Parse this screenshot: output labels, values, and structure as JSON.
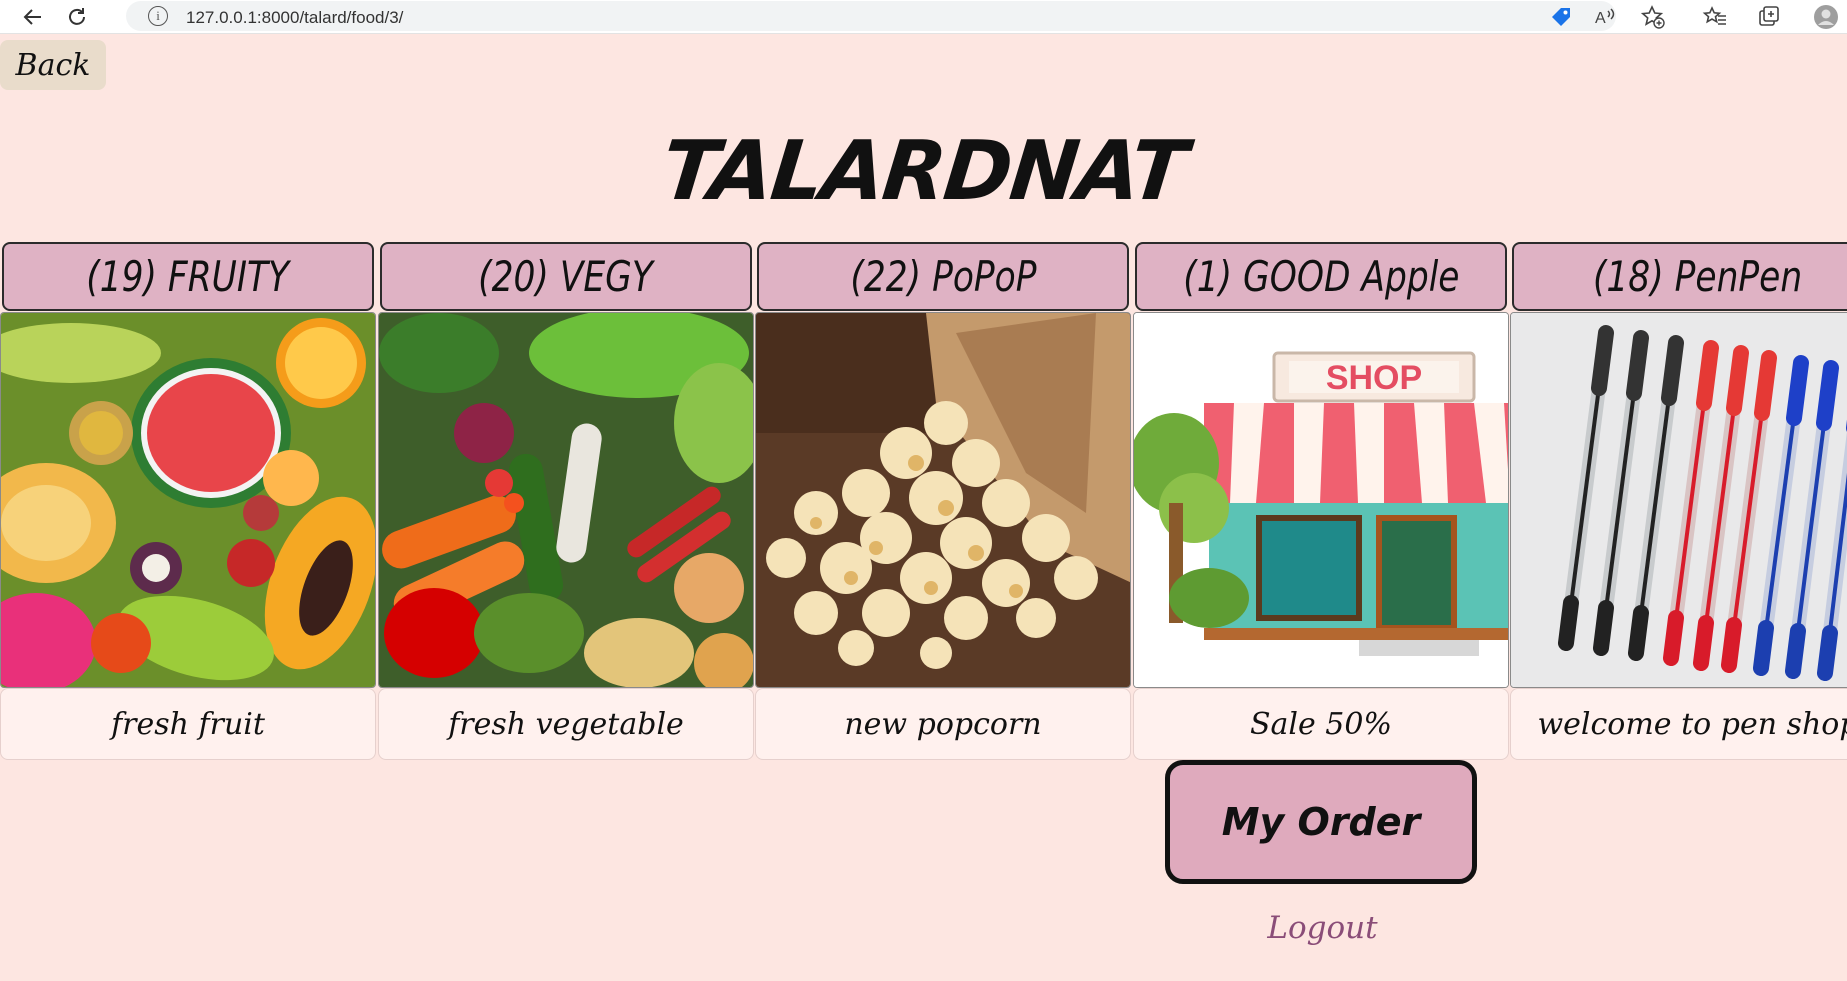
{
  "browser": {
    "url": "127.0.0.1:8000/talard/food/3/"
  },
  "page": {
    "back_label": "Back",
    "title": "TALARDNAT",
    "order_label": "My Order",
    "logout_label": "Logout"
  },
  "shops": [
    {
      "title": "(19) FRUITY",
      "description": "fresh fruit",
      "image": "fruit-image"
    },
    {
      "title": "(20) VEGY",
      "description": "fresh vegetable",
      "image": "vegetable-image"
    },
    {
      "title": "(22) PoPoP",
      "description": "new popcorn",
      "image": "popcorn-image"
    },
    {
      "title": "(1) GOOD Apple",
      "description": "Sale 50%",
      "image": "shop-storefront-image"
    },
    {
      "title": "(18) PenPen",
      "description": "welcome to pen shop",
      "image": "pens-image"
    }
  ],
  "colors": {
    "background": "#fde6e1",
    "header_pink": "#dfb2c4",
    "order_button": "#dfaabd",
    "logout_link": "#8a4d78",
    "back_button": "#e9dccb"
  }
}
